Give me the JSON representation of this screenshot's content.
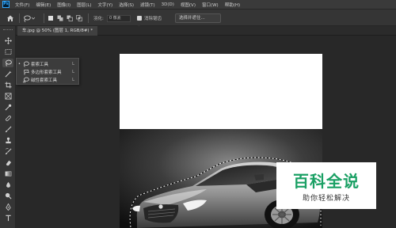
{
  "app": {
    "logo": "Ps"
  },
  "menu": [
    "文件(F)",
    "编辑(E)",
    "图像(I)",
    "图层(L)",
    "文字(Y)",
    "选择(S)",
    "滤镜(T)",
    "3D(D)",
    "视图(V)",
    "窗口(W)",
    "帮助(H)"
  ],
  "options": {
    "feather_label": "羽化:",
    "feather_value": "0 像素",
    "antialias_label": "消除锯齿",
    "antialias_checked": true,
    "select_subject_label": "选择并遮住..."
  },
  "document": {
    "tab_title": "车.jpg @ 50% (图层 1, RGB/8#) *"
  },
  "flyout": {
    "items": [
      {
        "label": "套索工具",
        "key": "L",
        "icon": "lasso-icon",
        "selected": true
      },
      {
        "label": "多边形套索工具",
        "key": "L",
        "icon": "polygonal-lasso-icon",
        "selected": false
      },
      {
        "label": "磁性套索工具",
        "key": "L",
        "icon": "magnetic-lasso-icon",
        "selected": false
      }
    ],
    "bullet": "•"
  },
  "tools": [
    "move-tool-icon",
    "marquee-tool-icon",
    "lasso-tool-icon",
    "magic-wand-icon",
    "crop-tool-icon",
    "frame-tool-icon",
    "eyedropper-icon",
    "healing-brush-icon",
    "brush-icon",
    "clone-stamp-icon",
    "history-brush-icon",
    "eraser-icon",
    "gradient-icon",
    "blur-icon",
    "dodge-icon",
    "pen-icon",
    "type-icon",
    "path-select-icon"
  ],
  "watermark": {
    "title": "百科全说",
    "subtitle": "助你轻松解决"
  },
  "colors": {
    "accent": "#1aa064",
    "ps_blue": "#31a8ff",
    "panel": "#353535",
    "workspace": "#282828"
  }
}
